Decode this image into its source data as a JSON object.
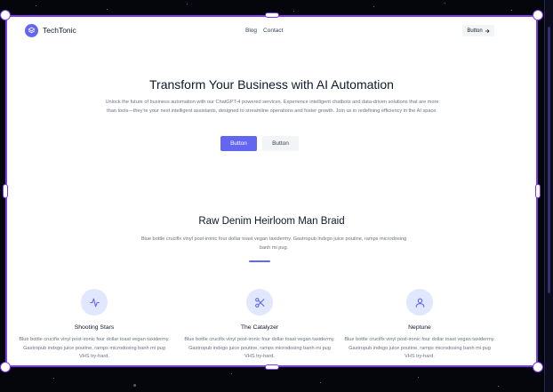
{
  "brand": {
    "name": "TechTonic",
    "accent": "#6366f1",
    "frame_color": "#7c3aed",
    "logo_icon": "layers-icon"
  },
  "nav": {
    "links": [
      "Blog",
      "Contact"
    ],
    "button_label": "Button",
    "button_icon": "arrow-right-icon"
  },
  "hero": {
    "title": "Transform Your Business with AI Automation",
    "description": "Unlock the future of business automation with our ChatGPT-4 powered services. Experience intelligent chatbots and data-driven solutions that are more than tools—they're your next intelligent assistants, designed to streamline operations and foster growth. Join us in redefining efficiency in the AI space.",
    "primary_button": "Button",
    "secondary_button": "Button"
  },
  "features": {
    "title": "Raw Denim Heirloom Man Braid",
    "description": "Blue bottle crucifix vinyl post-ironic four dollar toast vegan taxidermy. Gastropub indxgo juice poutine, ramps microdosing banh mi pug.",
    "cards": [
      {
        "title": "Shooting Stars",
        "icon": "activity-icon",
        "text": "Blue bottle crucifix vinyl post-ironic four dollar toast vegan taxidermy. Gastropub indxgo juice poutine, ramps microdosing banh mi pug VHS try-hard."
      },
      {
        "title": "The Catalyzer",
        "icon": "scissors-icon",
        "text": "Blue bottle crucifix vinyl post-ironic four dollar toast vegan taxidermy. Gastropub indxgo juice poutine, ramps microdosing banh mi pug VHS try-hard."
      },
      {
        "title": "Neptune",
        "icon": "user-icon",
        "text": "Blue bottle crucifix vinyl post-ironic four dollar toast vegan taxidermy. Gastropub indxgo juice poutine, ramps microdosing banh mi pug VHS try-hard."
      }
    ]
  }
}
